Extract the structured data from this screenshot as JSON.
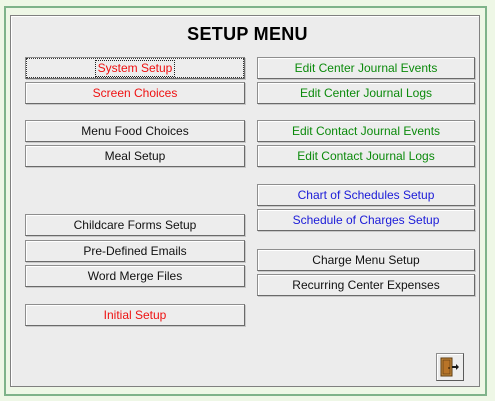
{
  "window": {
    "title": "SETUP MENU"
  },
  "left_column": {
    "system_setup": "System Setup",
    "screen_choices": "Screen Choices",
    "menu_food_choices": "Menu Food Choices",
    "meal_setup": "Meal Setup",
    "childcare_forms_setup": "Childcare Forms Setup",
    "pre_defined_emails": "Pre-Defined Emails",
    "word_merge_files": "Word Merge Files",
    "initial_setup": "Initial Setup"
  },
  "right_column": {
    "edit_center_journal_events": "Edit Center Journal Events",
    "edit_center_journal_logs": "Edit Center Journal Logs",
    "edit_contact_journal_events": "Edit Contact Journal Events",
    "edit_contact_journal_logs": "Edit Contact Journal Logs",
    "chart_of_schedules_setup": "Chart of Schedules Setup",
    "schedule_of_charges_setup": "Schedule of Charges Setup",
    "charge_menu_setup": "Charge Menu Setup",
    "recurring_center_expenses": "Recurring Center Expenses"
  },
  "icons": {
    "exit": "exit-door-icon"
  },
  "colors": {
    "window_background": "#eef7e6",
    "red_text": "#ee1111",
    "green_text": "#0b8a0b",
    "blue_text": "#1a1ad8"
  }
}
